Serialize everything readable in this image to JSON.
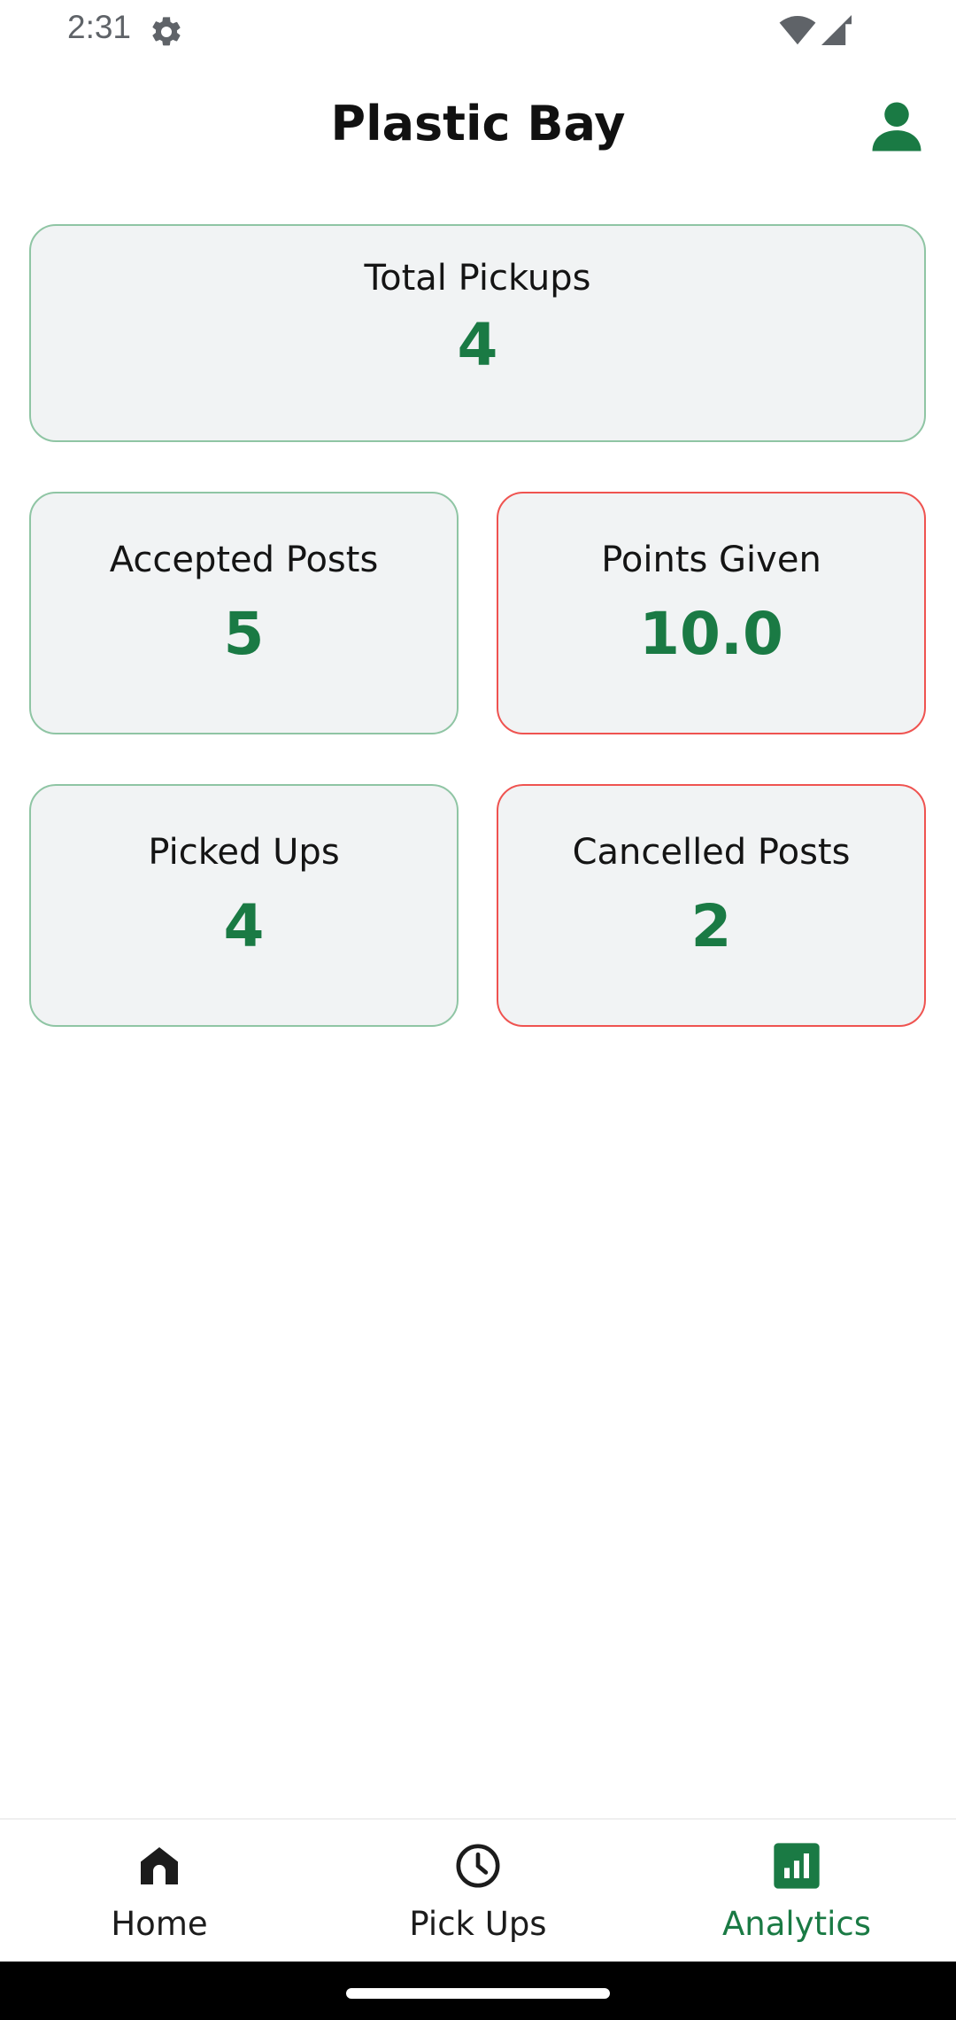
{
  "status_bar": {
    "time": "2:31"
  },
  "app_bar": {
    "title": "Plastic Bay"
  },
  "stats": {
    "total_pickups": {
      "label": "Total Pickups",
      "value": "4"
    },
    "accepted_posts": {
      "label": "Accepted Posts",
      "value": "5"
    },
    "points_given": {
      "label": "Points Given",
      "value": "10.0"
    },
    "picked_ups": {
      "label": "Picked Ups",
      "value": "4"
    },
    "cancelled_posts": {
      "label": "Cancelled Posts",
      "value": "2"
    }
  },
  "bottom_nav": {
    "items": [
      {
        "label": "Home",
        "icon": "home-icon",
        "active": false
      },
      {
        "label": "Pick Ups",
        "icon": "clock-icon",
        "active": false
      },
      {
        "label": "Analytics",
        "icon": "analytics-icon",
        "active": true
      }
    ]
  },
  "colors": {
    "accent_green": "#1a7a44",
    "card_border_green": "#8fc5a4",
    "card_border_red": "#ef5350",
    "card_background": "#f1f3f4"
  }
}
